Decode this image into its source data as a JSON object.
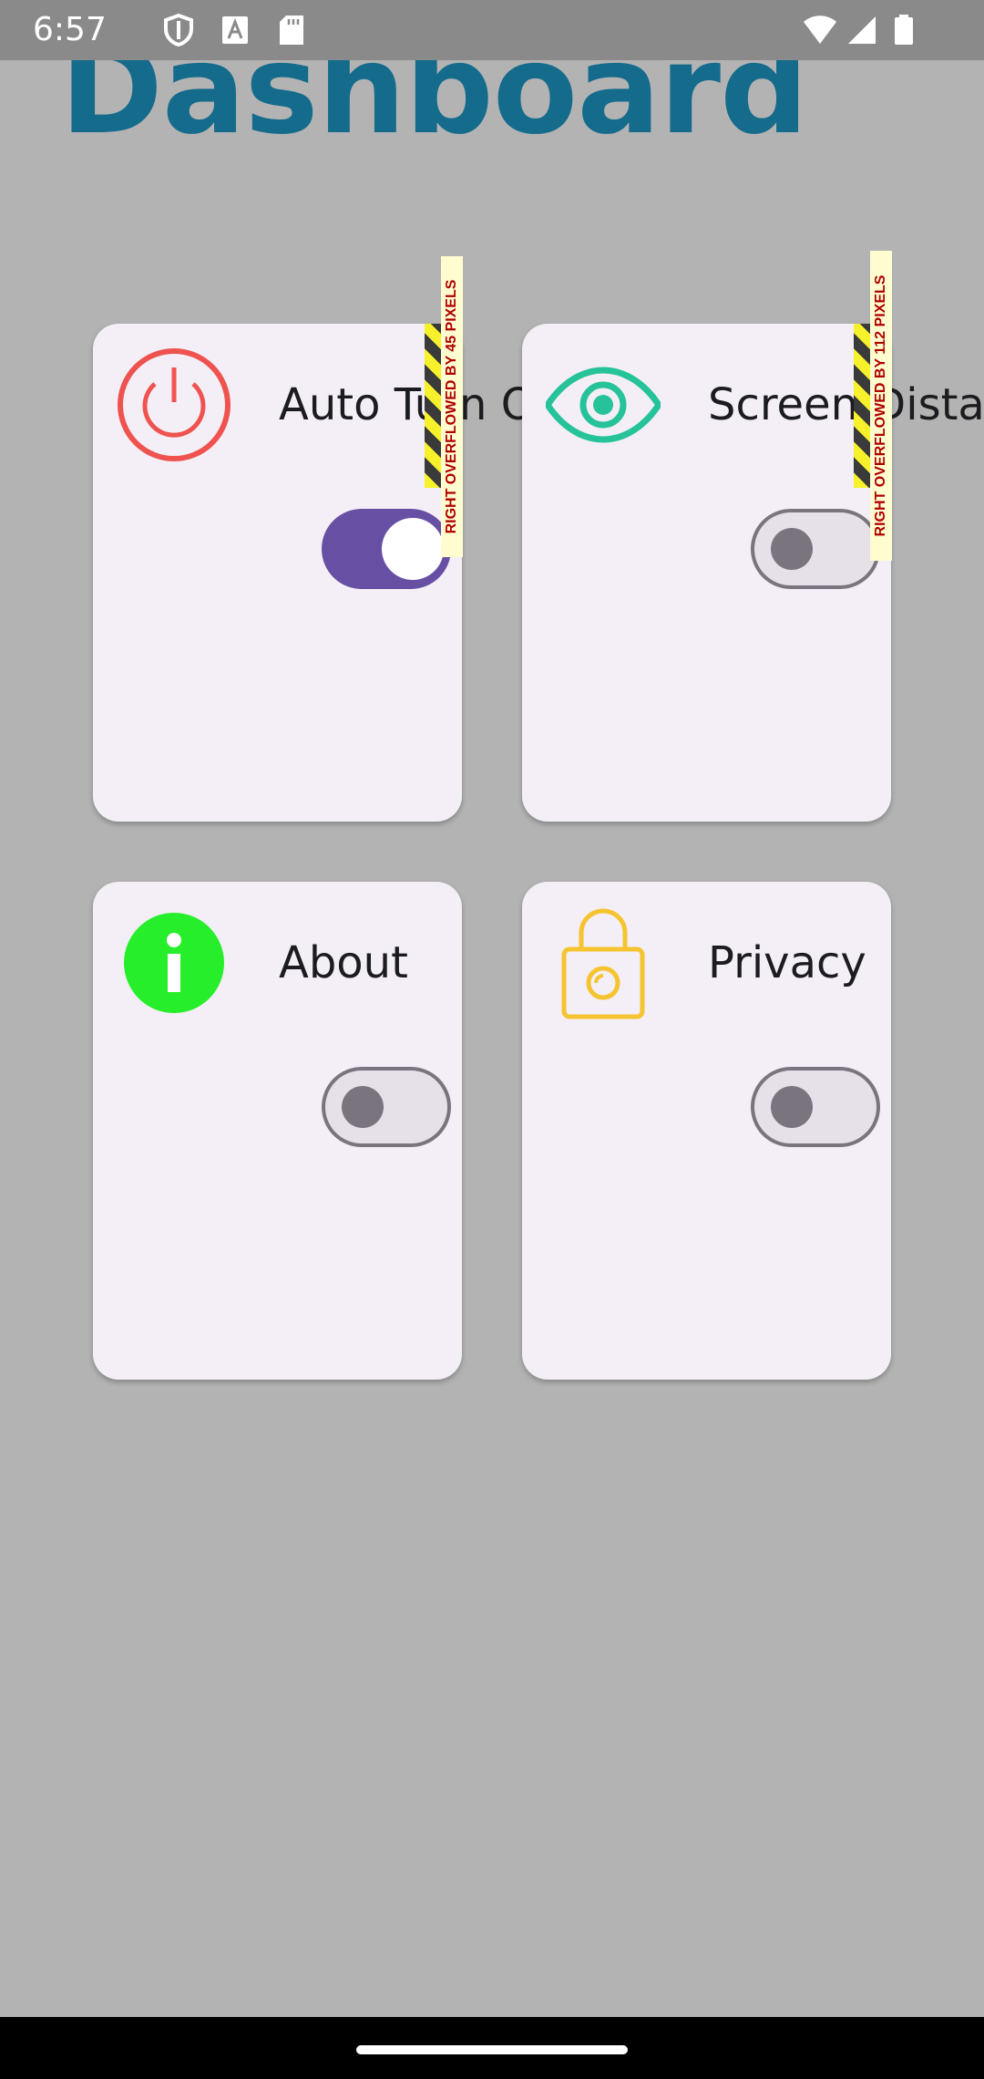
{
  "status_bar": {
    "time": "6:57",
    "left_icons": [
      "shield-icon",
      "text-a-icon",
      "sd-card-icon"
    ],
    "right_icons": [
      "wifi-icon",
      "cell-signal-icon",
      "battery-icon"
    ]
  },
  "title": "Dashboard",
  "cards": [
    {
      "label": "Auto Turn Off",
      "icon": "power-icon",
      "icon_color": "#ef5350",
      "toggle_on": true,
      "overflow_text": "RIGHT OVERFLOWED BY 45 PIXELS"
    },
    {
      "label": "Screen Distance",
      "icon": "eye-icon",
      "icon_color": "#26c39a",
      "toggle_on": false,
      "overflow_text": "RIGHT OVERFLOWED BY 112 PIXELS"
    },
    {
      "label": "About",
      "icon": "info-icon",
      "icon_color": "#27ee2b",
      "toggle_on": false,
      "overflow_text": ""
    },
    {
      "label": "Privacy",
      "icon": "lock-icon",
      "icon_color": "#f5c430",
      "toggle_on": false,
      "overflow_text": ""
    }
  ],
  "colors": {
    "title": "#146b8c",
    "scrim_background": "#b3b3b3",
    "card_background": "#f4eff6",
    "toggle_on_track": "#6750a4",
    "toggle_off_track": "#e6e0e9",
    "toggle_outline": "#79747e"
  }
}
